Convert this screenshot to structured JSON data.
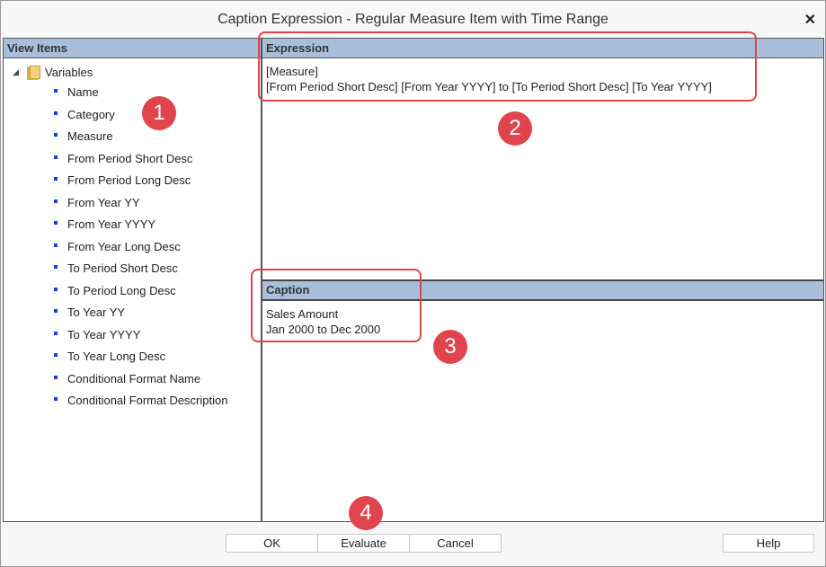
{
  "dialog": {
    "title": "Caption Expression - Regular Measure Item with Time Range",
    "close_glyph": "✕"
  },
  "view_items": {
    "header": "View Items",
    "root_label": "Variables",
    "items": [
      "Name",
      "Category",
      "Measure",
      "From Period Short Desc",
      "From Period Long Desc",
      "From Year YY",
      "From Year YYYY",
      "From Year Long Desc",
      "To Period Short Desc",
      "To Period Long Desc",
      "To Year YY",
      "To Year YYYY",
      "To Year Long Desc",
      "Conditional Format Name",
      "Conditional Format Description"
    ]
  },
  "expression": {
    "header": "Expression",
    "line1": "[Measure]",
    "line2": "[From Period Short Desc] [From Year YYYY] to [To Period Short Desc] [To Year YYYY]"
  },
  "caption": {
    "header": "Caption",
    "line1": "Sales Amount",
    "line2": "Jan 2000 to Dec 2000"
  },
  "callouts": [
    "1",
    "2",
    "3",
    "4"
  ],
  "buttons": {
    "ok": "OK",
    "evaluate": "Evaluate",
    "cancel": "Cancel",
    "help": "Help"
  },
  "colors": {
    "header_bg": "#a8bfdc",
    "callout": "#e0444c",
    "bullet": "#1a3fd6"
  }
}
